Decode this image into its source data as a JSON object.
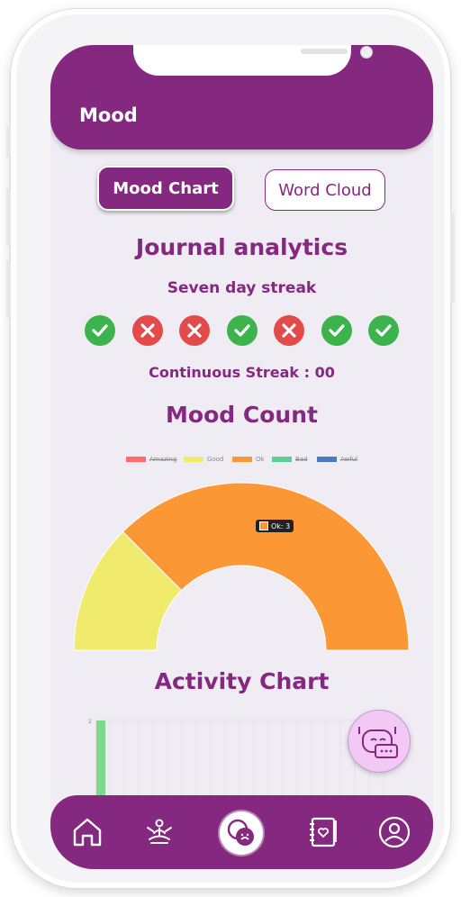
{
  "header": {
    "title": "Mood"
  },
  "tabs": [
    {
      "label": "Mood Chart",
      "active": true
    },
    {
      "label": "Word Cloud",
      "active": false
    }
  ],
  "analytics": {
    "title": "Journal analytics",
    "streak_label": "Seven day streak",
    "days": [
      "check",
      "cross",
      "cross",
      "check",
      "cross",
      "check",
      "check"
    ],
    "continuous_streak": "Continuous Streak : 00"
  },
  "mood_count": {
    "title": "Mood Count",
    "tooltip": "Ok: 3"
  },
  "chart_data": {
    "type": "pie",
    "variant": "half-doughnut",
    "legend": [
      {
        "name": "Amazing",
        "color": "#ff6b6b",
        "hidden": true
      },
      {
        "name": "Good",
        "color": "#f1eb6d",
        "hidden": false
      },
      {
        "name": "Ok",
        "color": "#fb9735",
        "hidden": false
      },
      {
        "name": "Bad",
        "color": "#56d096",
        "hidden": true
      },
      {
        "name": "Awful",
        "color": "#4a7bc2",
        "hidden": true
      }
    ],
    "slices": [
      {
        "name": "Good",
        "value": 1,
        "color": "#f1eb6d"
      },
      {
        "name": "Ok",
        "value": 3,
        "color": "#fb9735"
      }
    ],
    "legend_position": "top"
  },
  "activity": {
    "title": "Activity Chart",
    "y_tick": "2",
    "bar_color": "#7ed98f"
  },
  "colors": {
    "brand": "#852880",
    "check": "#3cb34d",
    "cross": "#e34a4a"
  },
  "nav": [
    {
      "name": "home-icon"
    },
    {
      "name": "meditation-icon"
    },
    {
      "name": "mood-icon",
      "active": true
    },
    {
      "name": "journal-icon"
    },
    {
      "name": "profile-icon"
    }
  ]
}
